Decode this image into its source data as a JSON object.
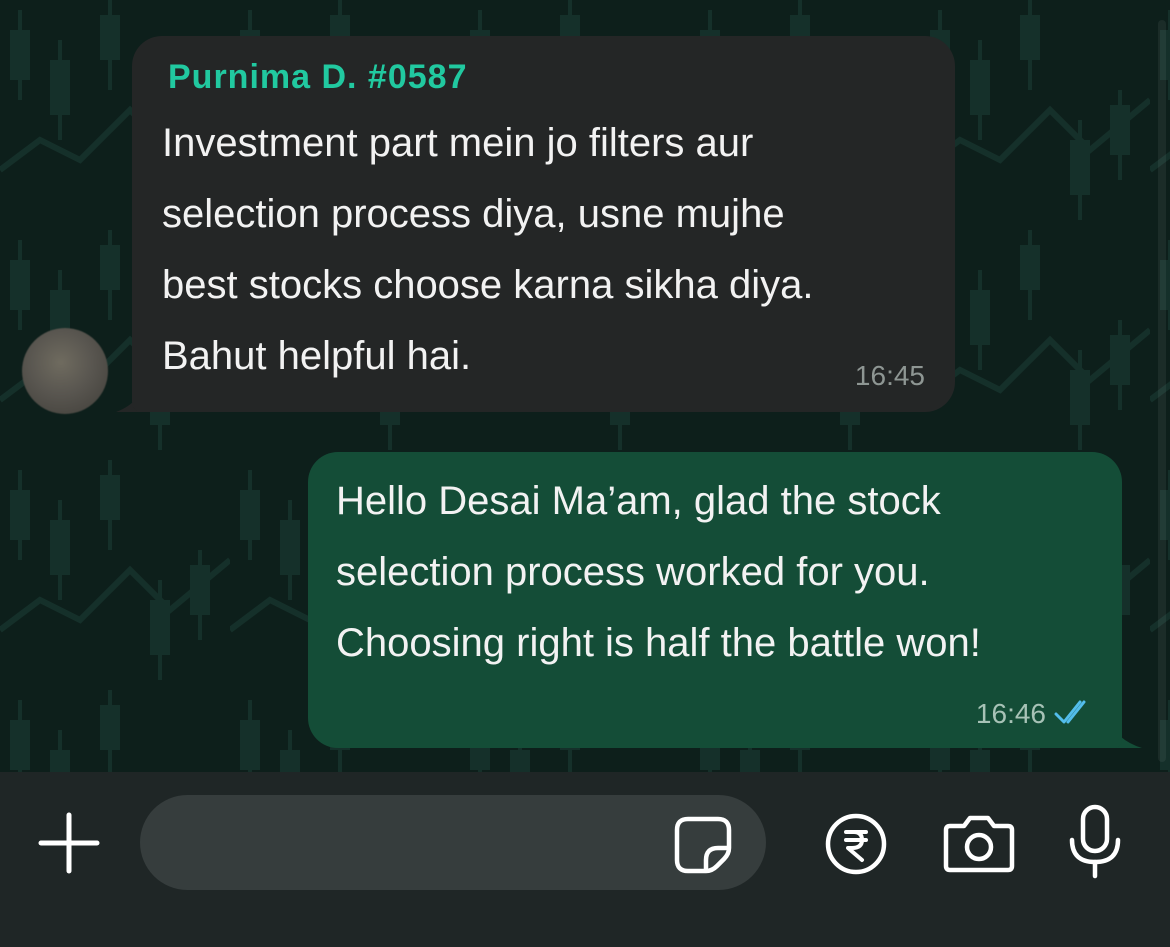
{
  "chat": {
    "incoming": {
      "sender": "Purnima D. #0587",
      "text": "Investment part mein jo filters aur\nselection process diya, usne mujhe\nbest stocks choose karna sikha diya.\nBahut helpful hai.",
      "time": "16:45"
    },
    "outgoing": {
      "text": "Hello Desai Ma’am, glad the stock\nselection process worked for you.\nChoosing right is half the battle won!",
      "time": "16:46",
      "status": "read"
    }
  },
  "composer": {
    "placeholder": "",
    "value": ""
  },
  "icons": {
    "attach": "plus-icon",
    "sticker": "sticker-icon",
    "payment": "rupee-icon",
    "camera": "camera-icon",
    "voice": "microphone-icon",
    "read_receipt": "double-check-icon"
  },
  "colors": {
    "sender_name": "#21c9a0",
    "incoming_bubble": "#242626",
    "outgoing_bubble": "#144d37",
    "read_ticks": "#53bdeb",
    "chat_background": "#0d1f1b",
    "input_bar": "#1f2626"
  }
}
